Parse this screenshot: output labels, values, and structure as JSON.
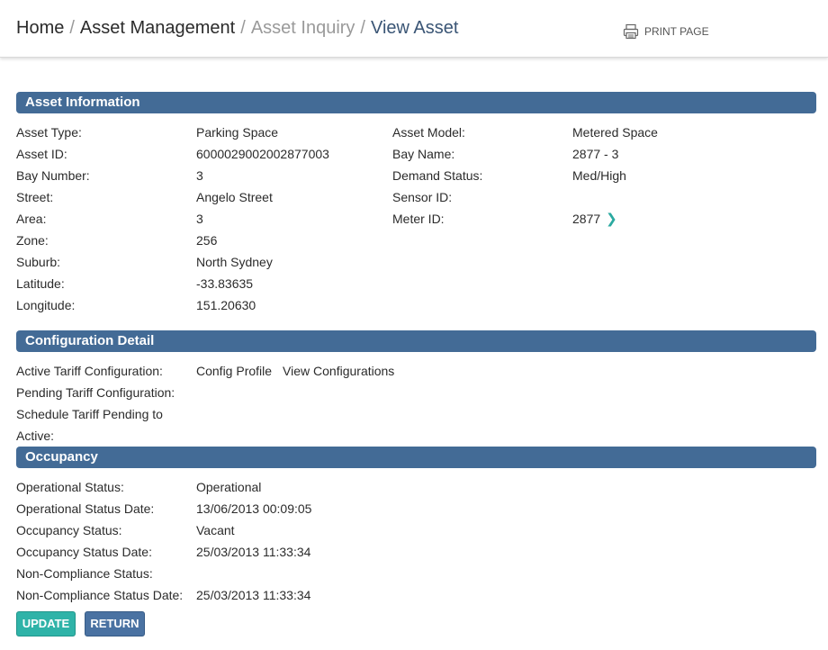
{
  "breadcrumb": {
    "home": "Home",
    "asset_management": "Asset Management",
    "asset_inquiry": "Asset Inquiry",
    "view_asset": "View Asset",
    "separator": "/"
  },
  "print_label": "PRINT PAGE",
  "asset_information": {
    "title": "Asset Information",
    "left": [
      {
        "label": "Asset Type:",
        "value": "Parking Space"
      },
      {
        "label": "Asset ID:",
        "value": "6000029002002877003"
      },
      {
        "label": "Bay Number:",
        "value": "3"
      },
      {
        "label": "Street:",
        "value": "Angelo Street"
      },
      {
        "label": "Area:",
        "value": "3"
      },
      {
        "label": "Zone:",
        "value": "256"
      },
      {
        "label": "Suburb:",
        "value": "North Sydney"
      },
      {
        "label": "Latitude:",
        "value": "-33.83635"
      },
      {
        "label": "Longitude:",
        "value": "151.20630"
      }
    ],
    "right": [
      {
        "label": "Asset Model:",
        "value": "Metered Space"
      },
      {
        "label": "Bay Name:",
        "value": "2877 - 3"
      },
      {
        "label": "Demand Status:",
        "value": "Med/High"
      },
      {
        "label": "Sensor ID:",
        "value": ""
      },
      {
        "label": "Meter ID:",
        "value": "2877"
      }
    ]
  },
  "configuration_detail": {
    "title": "Configuration Detail",
    "active_label": "Active Tariff Configuration:",
    "config_profile": "Config Profile",
    "view_configurations": "View Configurations",
    "pending_label": "Pending Tariff Configuration:",
    "schedule_label_line1": "Schedule Tariff Pending to",
    "schedule_label_line2": "Active:"
  },
  "occupancy": {
    "title": "Occupancy",
    "rows": [
      {
        "label": "Operational Status:",
        "value": "Operational"
      },
      {
        "label": "Operational Status Date:",
        "value": "13/06/2013 00:09:05"
      },
      {
        "label": "Occupancy Status:",
        "value": "Vacant"
      },
      {
        "label": "Occupancy Status Date:",
        "value": "25/03/2013 11:33:34"
      },
      {
        "label": "Non-Compliance Status:",
        "value": ""
      },
      {
        "label": "Non-Compliance Status Date:",
        "value": "25/03/2013 11:33:34"
      }
    ]
  },
  "buttons": {
    "update": "UPDATE",
    "return": "RETURN"
  },
  "colors": {
    "section_header": "#436b96",
    "update_button": "#2fb3a8",
    "return_button": "#4a72a2",
    "accent_chevron": "#2aa9a0"
  },
  "icons": {
    "print": "printer-icon",
    "meter_link": "chevron-right-icon"
  }
}
